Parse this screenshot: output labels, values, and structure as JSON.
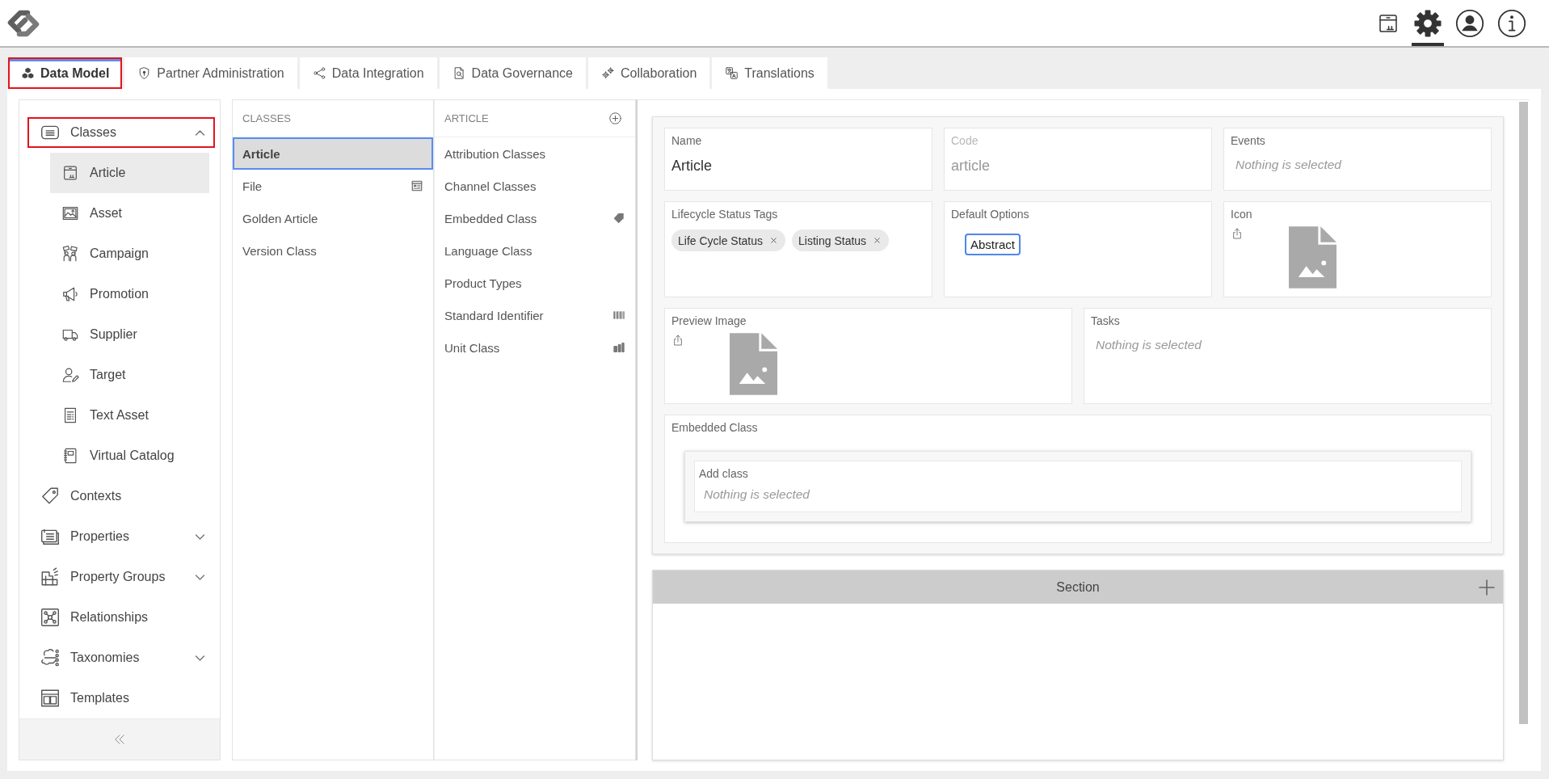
{
  "toolbar": [
    {
      "kind": "package",
      "selected": false
    },
    {
      "kind": "settings",
      "selected": true
    },
    {
      "kind": "profile",
      "selected": false
    },
    {
      "kind": "info",
      "selected": false
    }
  ],
  "tabs": [
    {
      "label": "Data Model",
      "kind": "cubes",
      "selected": true,
      "highlighted": true
    },
    {
      "label": "Partner Administration",
      "kind": "shield",
      "selected": false,
      "highlighted": false
    },
    {
      "label": "Data Integration",
      "kind": "nodes",
      "selected": false,
      "highlighted": false
    },
    {
      "label": "Data Governance",
      "kind": "doc-search",
      "selected": false,
      "highlighted": false
    },
    {
      "label": "Collaboration",
      "kind": "gears",
      "selected": false,
      "highlighted": false
    },
    {
      "label": "Translations",
      "kind": "translate",
      "selected": false,
      "highlighted": false
    }
  ],
  "sidebar": {
    "items": [
      {
        "label": "Classes",
        "kind": "classes",
        "selected": false,
        "highlighted": true,
        "expanded": true,
        "children": [
          {
            "label": "Article",
            "kind": "box",
            "selected": true
          },
          {
            "label": "Asset",
            "kind": "image",
            "selected": false
          },
          {
            "label": "Campaign",
            "kind": "campaign",
            "selected": false
          },
          {
            "label": "Promotion",
            "kind": "megaphone",
            "selected": false
          },
          {
            "label": "Supplier",
            "kind": "truck",
            "selected": false
          },
          {
            "label": "Target",
            "kind": "user-edit",
            "selected": false
          },
          {
            "label": "Text Asset",
            "kind": "document",
            "selected": false
          },
          {
            "label": "Virtual Catalog",
            "kind": "notebook",
            "selected": false
          }
        ]
      },
      {
        "label": "Contexts",
        "kind": "tag",
        "selected": false,
        "highlighted": false
      },
      {
        "label": "Properties",
        "kind": "cards",
        "selected": false,
        "highlighted": false,
        "expanded": false
      },
      {
        "label": "Property Groups",
        "kind": "blocks",
        "selected": false,
        "highlighted": false,
        "expanded": false
      },
      {
        "label": "Relationships",
        "kind": "network",
        "selected": false,
        "highlighted": false
      },
      {
        "label": "Taxonomies",
        "kind": "hierarchy",
        "selected": false,
        "highlighted": false,
        "expanded": false
      },
      {
        "label": "Templates",
        "kind": "layout",
        "selected": false,
        "highlighted": false
      }
    ]
  },
  "classes_column": {
    "title": "CLASSES",
    "items": [
      {
        "label": "Article",
        "kind": "plain",
        "selected": true
      },
      {
        "label": "File",
        "kind": "form",
        "selected": false
      },
      {
        "label": "Golden Article",
        "kind": "plain",
        "selected": false
      },
      {
        "label": "Version Class",
        "kind": "plain",
        "selected": false
      }
    ]
  },
  "article_column": {
    "title": "ARTICLE",
    "items": [
      {
        "label": "Attribution Classes",
        "kind": "plain",
        "selected": false
      },
      {
        "label": "Channel Classes",
        "kind": "plain",
        "selected": false
      },
      {
        "label": "Embedded Class",
        "kind": "tagfill",
        "selected": false
      },
      {
        "label": "Language Class",
        "kind": "plain",
        "selected": false
      },
      {
        "label": "Product Types",
        "kind": "plain",
        "selected": false
      },
      {
        "label": "Standard Identifier",
        "kind": "barcode",
        "selected": false
      },
      {
        "label": "Unit Class",
        "kind": "coins",
        "selected": false
      }
    ]
  },
  "form": {
    "rows": [
      [
        {
          "label": "Name",
          "kind": "text",
          "value": "Article",
          "disabled": false
        },
        {
          "label": "Code",
          "kind": "text",
          "value": "article",
          "disabled": true
        },
        {
          "label": "Events",
          "kind": "select",
          "placeholder": "Nothing is selected"
        }
      ],
      [
        {
          "label": "Lifecycle Status Tags",
          "kind": "tags",
          "tags": [
            "Life Cycle Status",
            "Listing Status"
          ]
        },
        {
          "label": "Default Options",
          "kind": "options",
          "options": [
            {
              "label": "Abstract",
              "selected": true
            }
          ]
        },
        {
          "label": "Icon",
          "kind": "image"
        }
      ],
      [
        {
          "label": "Preview Image",
          "kind": "image"
        },
        {
          "label": "Tasks",
          "kind": "select",
          "placeholder": "Nothing is selected"
        }
      ],
      [
        {
          "label": "Embedded Class",
          "kind": "embedded",
          "add": {
            "label": "Add class",
            "placeholder": "Nothing is selected"
          }
        }
      ]
    ]
  },
  "section": {
    "title": "Section"
  }
}
